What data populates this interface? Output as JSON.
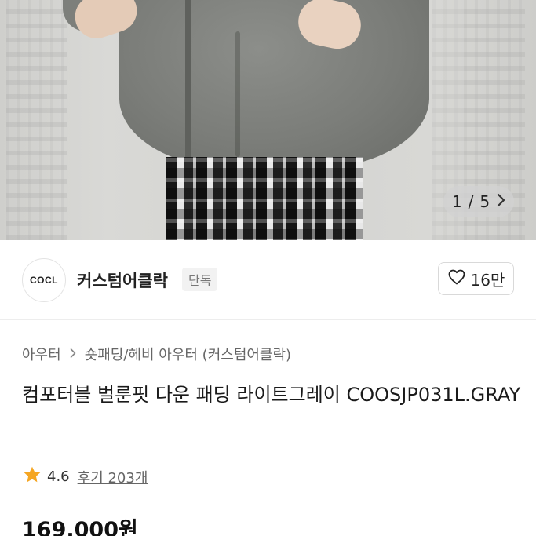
{
  "gallery": {
    "current": "1",
    "separator": "/",
    "total": "5",
    "next_icon": "chevron-right-icon"
  },
  "shop": {
    "logo_text": "COCL",
    "name": "커스텀어클락",
    "badge": "단독",
    "like_icon": "heart-outline-icon",
    "like_count": "16만"
  },
  "breadcrumb": {
    "category": "아우터",
    "separator_icon": "chevron-right-icon",
    "subcategory": "숏패딩/헤비 아우터 (커스텀어클락)"
  },
  "product": {
    "title": "컴포터블 벌룬핏 다운 패딩 라이트그레이 COOSJP031L.GRAY",
    "rating": "4.6",
    "rating_icon": "star-icon",
    "reviews": "후기 203개",
    "price": "169,000원"
  },
  "colors": {
    "star": "#f5a623",
    "text_primary": "#1a1a1a",
    "text_secondary": "#666666",
    "badge_bg": "#f2f2f2"
  }
}
